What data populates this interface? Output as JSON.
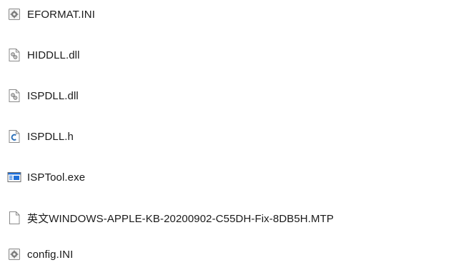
{
  "files": [
    {
      "name": "EFORMAT.INI",
      "icon": "ini-settings-icon"
    },
    {
      "name": "HIDDLL.dll",
      "icon": "dll-file-icon"
    },
    {
      "name": "ISPDLL.dll",
      "icon": "dll-file-icon"
    },
    {
      "name": "ISPDLL.h",
      "icon": "c-header-file-icon"
    },
    {
      "name": "ISPTool.exe",
      "icon": "exe-application-icon"
    },
    {
      "name": "英文WINDOWS-APPLE-KB-20200902-C55DH-Fix-8DB5H.MTP",
      "icon": "generic-file-icon"
    },
    {
      "name": "config.INI",
      "icon": "ini-settings-icon"
    }
  ],
  "colors": {
    "text": "#1a1a1a",
    "c_header_accent": "#2b6fb8",
    "exe_accent": "#1e6fd9"
  }
}
